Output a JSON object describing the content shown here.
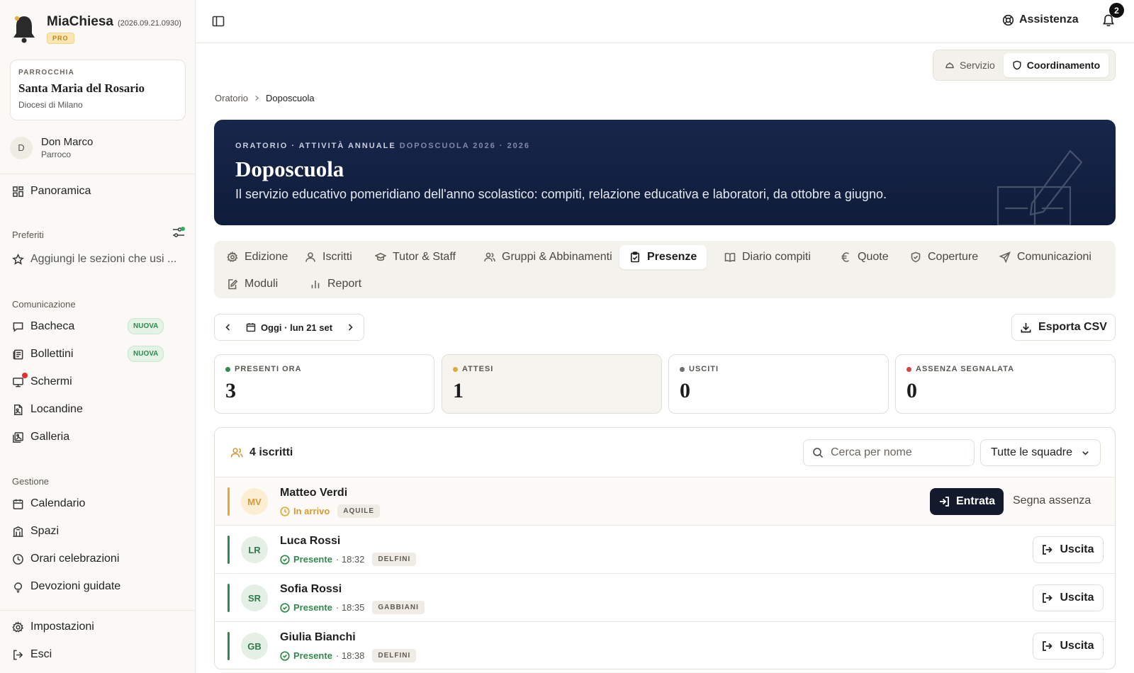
{
  "app": {
    "name": "MiaChiesa",
    "version": "(2026.09.21.0930)",
    "plan_badge": "PRO"
  },
  "parish": {
    "label": "PARROCCHIA",
    "name": "Santa Maria del Rosario",
    "diocese": "Diocesi di Milano"
  },
  "user": {
    "initial": "D",
    "name": "Don Marco",
    "role": "Parroco"
  },
  "sidebar": {
    "overview": "Panoramica",
    "favorites_label": "Preferiti",
    "favorites_hint": "Aggiungi le sezioni che usi ...",
    "communication_label": "Comunicazione",
    "communication_items": [
      {
        "label": "Bacheca",
        "badge": "NUOVA",
        "icon": "chat-bubble-icon"
      },
      {
        "label": "Bollettini",
        "badge": "NUOVA",
        "icon": "newspaper-icon"
      },
      {
        "label": "Schermi",
        "badge": "",
        "icon": "monitor-icon"
      },
      {
        "label": "Locandine",
        "badge": "",
        "icon": "poster-icon"
      },
      {
        "label": "Galleria",
        "badge": "",
        "icon": "gallery-icon"
      }
    ],
    "management_label": "Gestione",
    "management_items": [
      {
        "label": "Calendario",
        "icon": "calendar-icon"
      },
      {
        "label": "Spazi",
        "icon": "building-icon"
      },
      {
        "label": "Orari celebrazioni",
        "icon": "clock-icon"
      },
      {
        "label": "Devozioni guidate",
        "icon": "lightbulb-icon"
      }
    ],
    "settings": "Impostazioni",
    "logout": "Esci"
  },
  "topbar": {
    "help": "Assistenza",
    "notification_count": "2"
  },
  "mode_switch": {
    "options": [
      "Servizio",
      "Coordinamento"
    ],
    "active": "Coordinamento"
  },
  "breadcrumb": {
    "parent": "Oratorio",
    "current": "Doposcuola"
  },
  "hero": {
    "kicker": "ORATORIO · ATTIVITÀ ANNUALE",
    "kicker_dim": "DOPOSCUOLA 2026 · 2026",
    "title": "Doposcuola",
    "description": "Il servizio educativo pomeridiano dell'anno scolastico: compiti, relazione educativa e laboratori, da ottobre a giugno."
  },
  "tabs": [
    {
      "label": "Edizione",
      "icon": "gear-icon"
    },
    {
      "label": "Iscritti",
      "icon": "user-icon"
    },
    {
      "label": "Tutor & Staff",
      "icon": "graduation-cap-icon"
    },
    {
      "label": "Gruppi & Abbinamenti",
      "icon": "users-icon"
    },
    {
      "label": "Presenze",
      "icon": "clipboard-check-icon",
      "active": true
    },
    {
      "label": "Diario compiti",
      "icon": "book-icon"
    },
    {
      "label": "Quote",
      "icon": "euro-icon"
    },
    {
      "label": "Coperture",
      "icon": "shield-check-icon"
    },
    {
      "label": "Comunicazioni",
      "icon": "send-icon"
    },
    {
      "label": "Moduli",
      "icon": "form-edit-icon"
    },
    {
      "label": "Report",
      "icon": "bar-chart-icon"
    }
  ],
  "date_nav": {
    "label": "Oggi · lun 21 set"
  },
  "export_label": "Esporta CSV",
  "stats": [
    {
      "label": "PRESENTI ORA",
      "value": "3",
      "color": "#2f8a4c"
    },
    {
      "label": "ATTESI",
      "value": "1",
      "color": "#e0a93a"
    },
    {
      "label": "USCITI",
      "value": "0",
      "color": "#6f6f6f"
    },
    {
      "label": "ASSENZA SEGNALATA",
      "value": "0",
      "color": "#d6453c"
    }
  ],
  "roster": {
    "count_label": "4 iscritti",
    "search_placeholder": "Cerca per nome",
    "squad_filter": "Tutte le squadre",
    "entries": [
      {
        "initials": "MV",
        "name": "Matteo Verdi",
        "status": "In arrivo",
        "time": "",
        "squad": "AQUILE",
        "action": "Entrata",
        "secondary_action": "Segna assenza",
        "state": "pending"
      },
      {
        "initials": "LR",
        "name": "Luca Rossi",
        "status": "Presente",
        "time": "· 18:32",
        "squad": "DELFINI",
        "action": "Uscita",
        "state": "present"
      },
      {
        "initials": "SR",
        "name": "Sofia Rossi",
        "status": "Presente",
        "time": "· 18:35",
        "squad": "GABBIANI",
        "action": "Uscita",
        "state": "present"
      },
      {
        "initials": "GB",
        "name": "Giulia Bianchi",
        "status": "Presente",
        "time": "· 18:38",
        "squad": "DELFINI",
        "action": "Uscita",
        "state": "present"
      }
    ]
  },
  "colors": {
    "hero_bg": "#16244a",
    "present": "#2f8a4c",
    "pending": "#e0a93a",
    "primary_button": "#121a2c"
  }
}
